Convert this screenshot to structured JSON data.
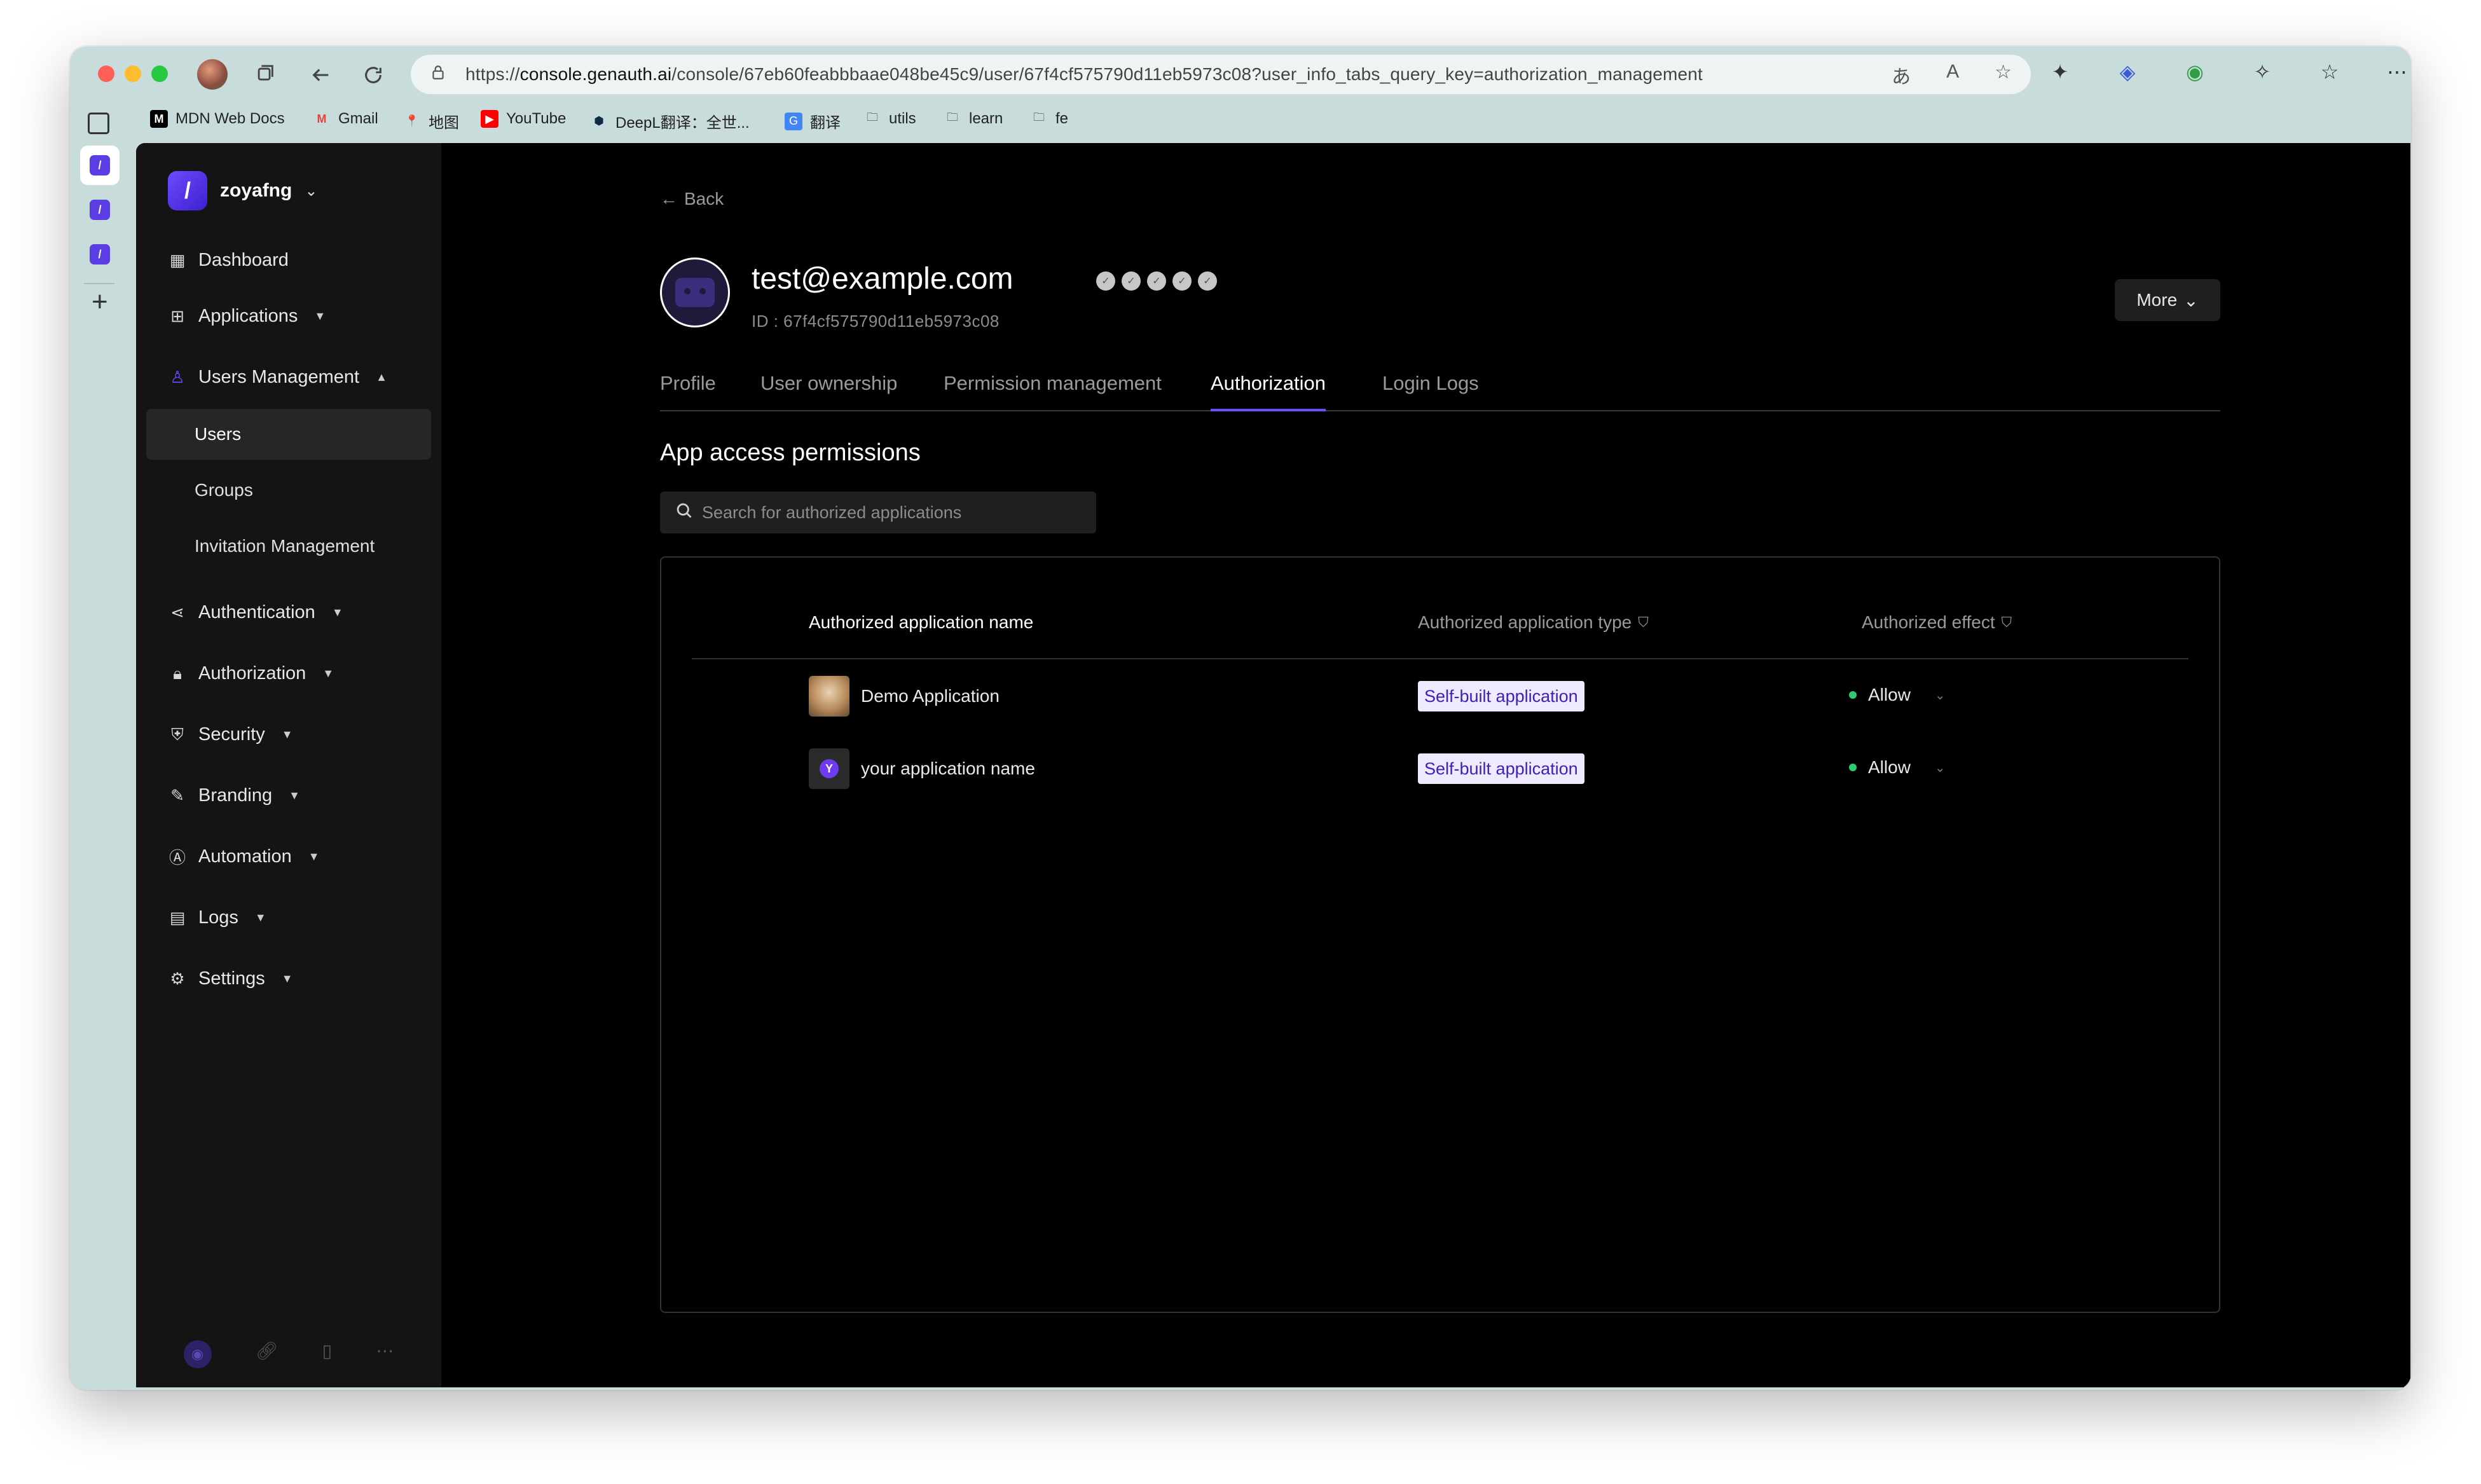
{
  "browser": {
    "url_prefix": "https://",
    "url_domain": "console.genauth.ai",
    "url_path": "/console/67eb60feabbbaae048be45c9/user/67f4cf575790d11eb5973c08?user_info_tabs_query_key=authorization_management",
    "bookmarks": [
      {
        "label": "MDN Web Docs",
        "icon": "mdn-icon"
      },
      {
        "label": "Gmail",
        "icon": "gmail-icon"
      },
      {
        "label": "地图",
        "icon": "maps-icon"
      },
      {
        "label": "YouTube",
        "icon": "youtube-icon"
      },
      {
        "label": "DeepL翻译：全世...",
        "icon": "deepl-icon"
      },
      {
        "label": "翻译",
        "icon": "translate-icon"
      },
      {
        "label": "utils",
        "icon": "folder-icon"
      },
      {
        "label": "learn",
        "icon": "folder-icon"
      },
      {
        "label": "fe",
        "icon": "folder-icon"
      }
    ]
  },
  "sidebar": {
    "tenant_name": "zoyafng",
    "items": [
      {
        "label": "Dashboard",
        "icon": "dashboard-icon"
      },
      {
        "label": "Applications",
        "icon": "apps-icon"
      },
      {
        "label": "Users Management",
        "icon": "users-icon"
      },
      {
        "label": "Authentication",
        "icon": "share-icon"
      },
      {
        "label": "Authorization",
        "icon": "lock-icon"
      },
      {
        "label": "Security",
        "icon": "shield-icon"
      },
      {
        "label": "Branding",
        "icon": "brush-icon"
      },
      {
        "label": "Automation",
        "icon": "automation-icon"
      },
      {
        "label": "Logs",
        "icon": "logs-icon"
      },
      {
        "label": "Settings",
        "icon": "gear-icon"
      }
    ],
    "sub_items": [
      "Users",
      "Groups",
      "Invitation Management"
    ]
  },
  "header": {
    "back_label": "Back",
    "user_email": "test@example.com",
    "user_id": "ID : 67f4cf575790d11eb5973c08",
    "more_label": "More"
  },
  "tabs": [
    "Profile",
    "User ownership",
    "Permission management",
    "Authorization",
    "Login Logs"
  ],
  "active_tab": "Authorization",
  "section_title": "App access permissions",
  "search": {
    "placeholder": "Search for authorized applications"
  },
  "table": {
    "columns": [
      "Authorized application name",
      "Authorized application type",
      "Authorized effect"
    ],
    "rows": [
      {
        "name": "Demo Application",
        "type": "Self-built application",
        "effect": "Allow"
      },
      {
        "name": "your application name",
        "type": "Self-built application",
        "effect": "Allow"
      }
    ]
  },
  "colors": {
    "accent": "#6d4bff",
    "allow": "#2ecc71",
    "tag_bg": "#efeaff",
    "tag_text": "#3d22b8"
  }
}
